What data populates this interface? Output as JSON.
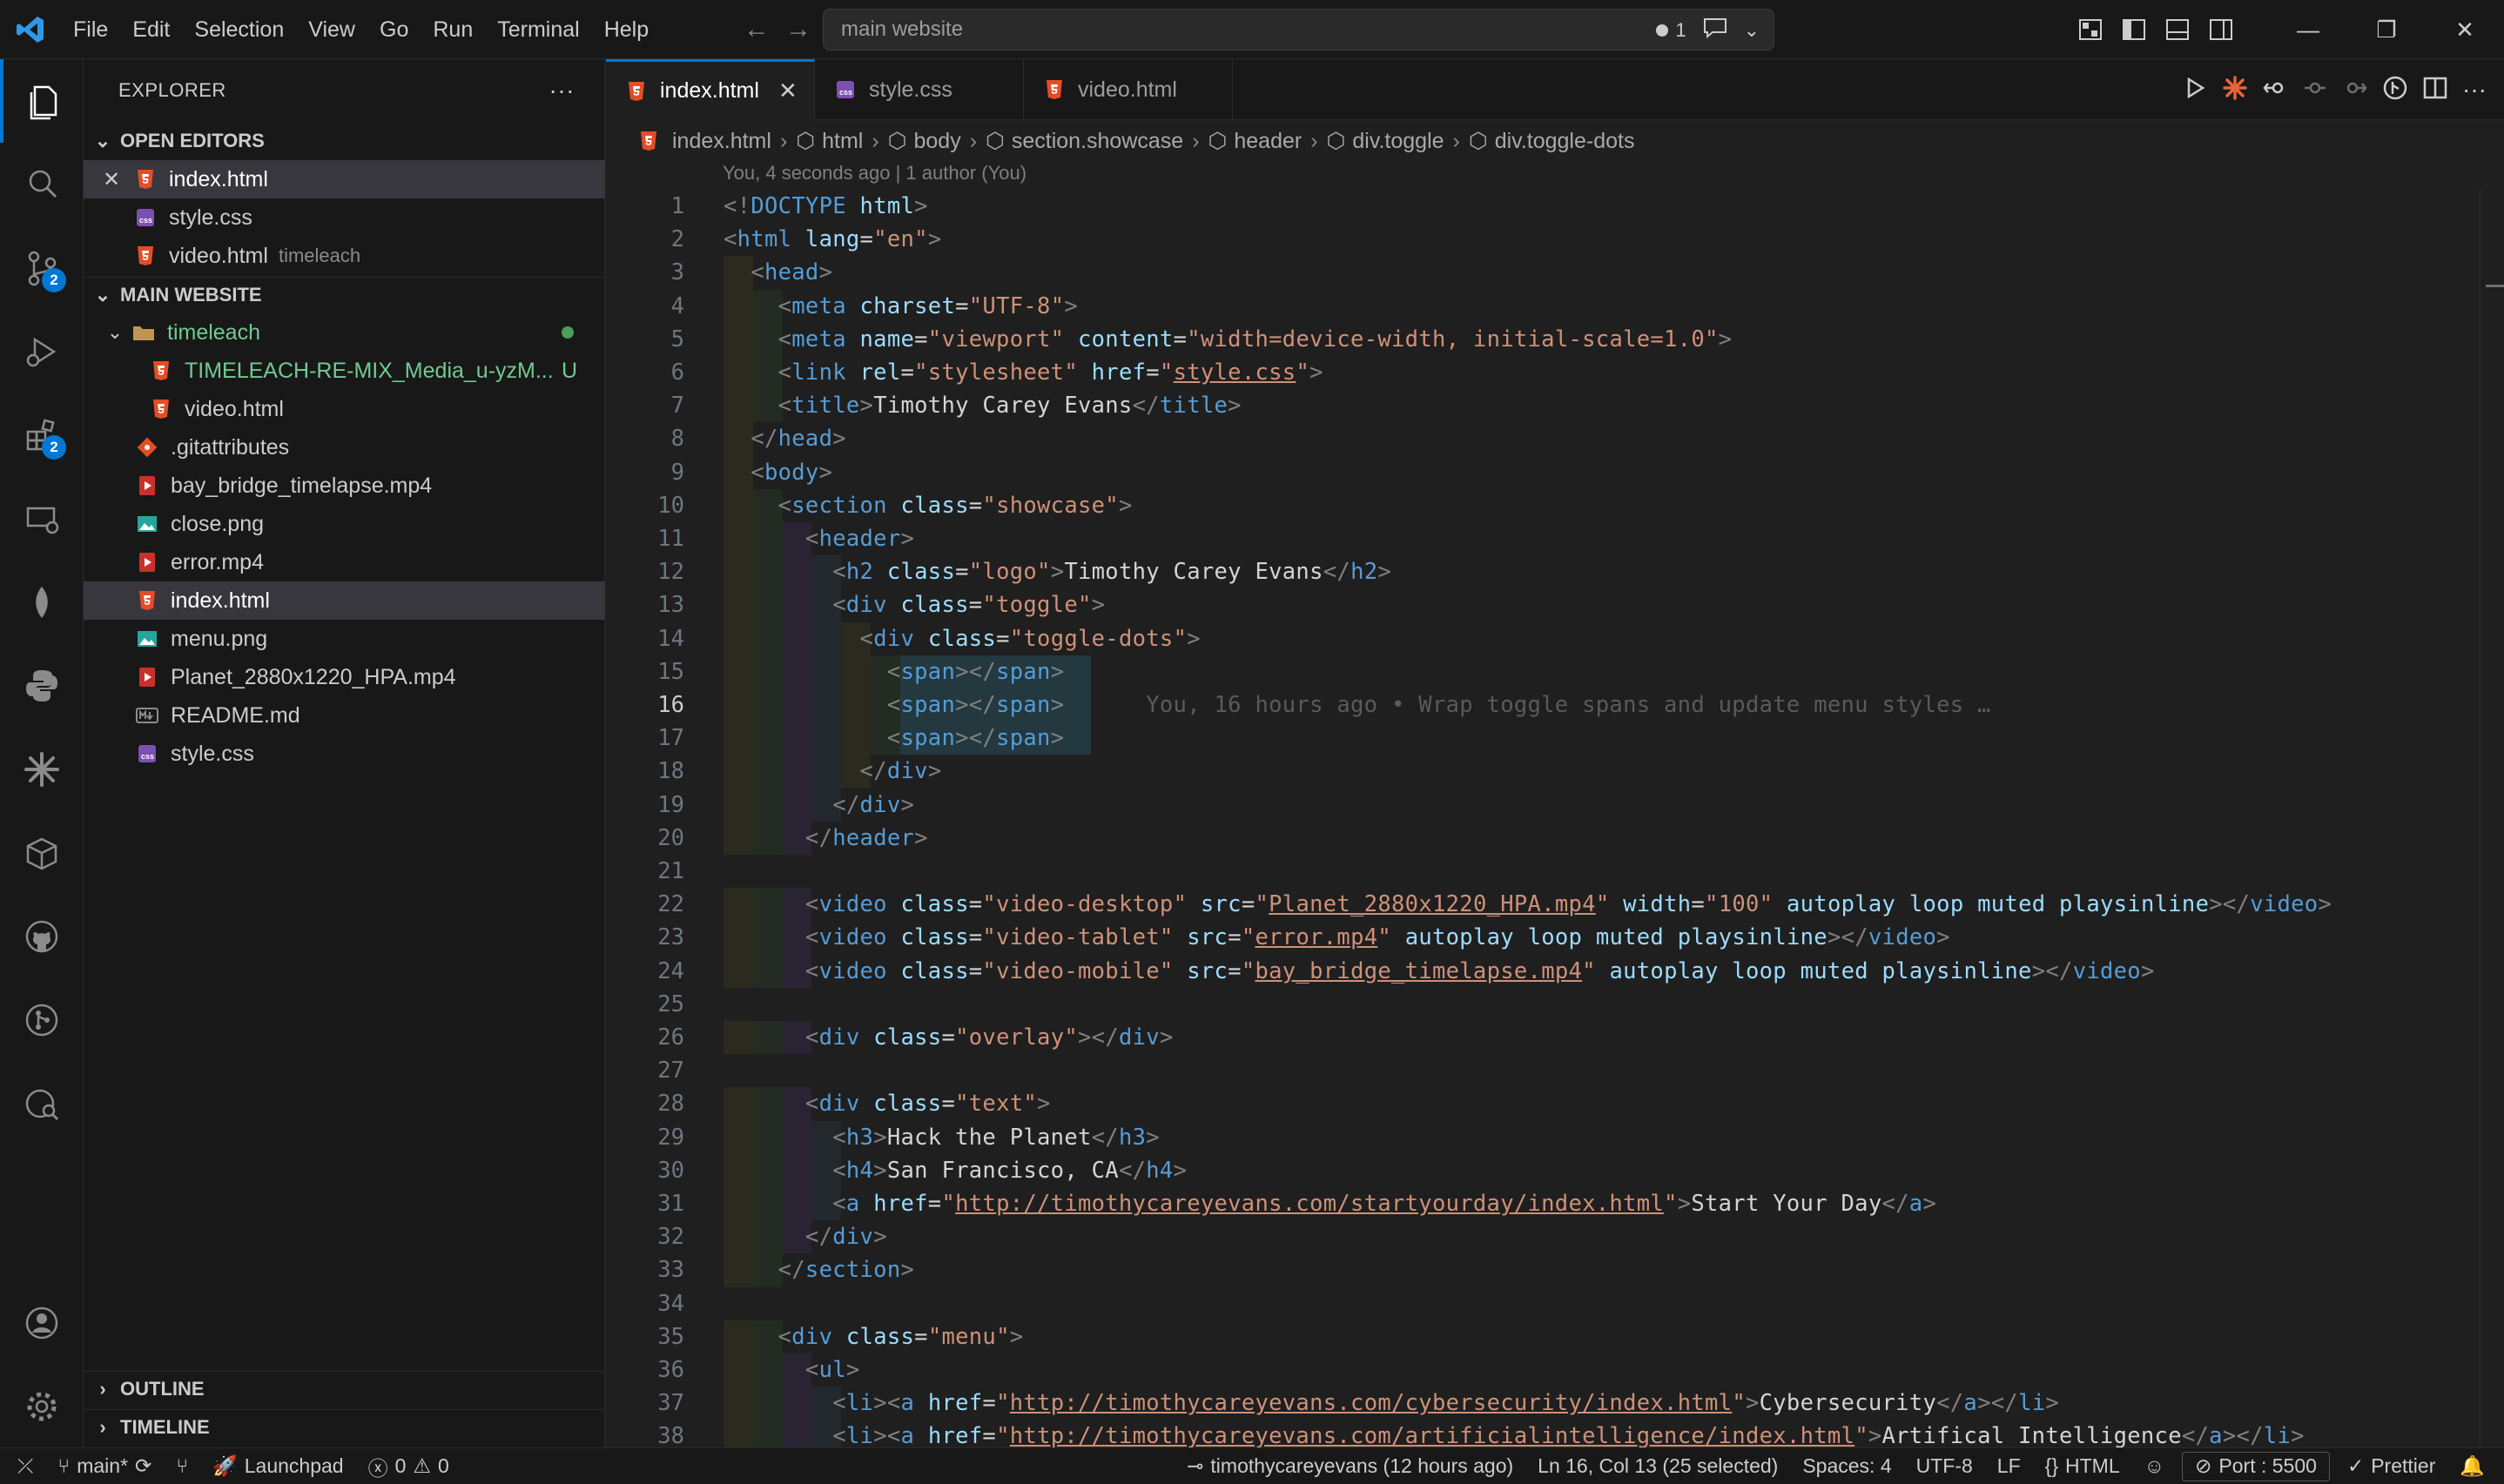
{
  "menu": [
    "File",
    "Edit",
    "Selection",
    "View",
    "Go",
    "Run",
    "Terminal",
    "Help"
  ],
  "command_center": {
    "text": "main website",
    "problems": "1"
  },
  "sidebar": {
    "title": "EXPLORER",
    "open_editors_title": "OPEN EDITORS",
    "open_editors": [
      {
        "name": "index.html",
        "desc": "",
        "icon": "html5-icon"
      },
      {
        "name": "style.css",
        "desc": "",
        "icon": "css-icon"
      },
      {
        "name": "video.html",
        "desc": "timeleach",
        "icon": "html5-icon"
      }
    ],
    "workspace_title": "MAIN WEBSITE",
    "tree": [
      {
        "name": "timeleach",
        "type": "folder"
      },
      {
        "name": "TIMELEACH-RE-MIX_Media_u-yzM...",
        "badge": "U",
        "type": "file"
      },
      {
        "name": "video.html",
        "type": "file"
      },
      {
        "name": ".gitattributes",
        "type": "file"
      },
      {
        "name": "bay_bridge_timelapse.mp4",
        "type": "file"
      },
      {
        "name": "close.png",
        "type": "file"
      },
      {
        "name": "error.mp4",
        "type": "file"
      },
      {
        "name": "index.html",
        "type": "file"
      },
      {
        "name": "menu.png",
        "type": "file"
      },
      {
        "name": "Planet_2880x1220_HPA.mp4",
        "type": "file"
      },
      {
        "name": "README.md",
        "type": "file"
      },
      {
        "name": "style.css",
        "type": "file"
      }
    ],
    "outline": "OUTLINE",
    "timeline": "TIMELINE",
    "badges": {
      "scm": "2",
      "extensions": "2"
    }
  },
  "tabs": [
    {
      "label": "index.html"
    },
    {
      "label": "style.css"
    },
    {
      "label": "video.html"
    }
  ],
  "breadcrumb": [
    "index.html",
    "html",
    "body",
    "section.showcase",
    "header",
    "div.toggle",
    "div.toggle-dots"
  ],
  "blame_header": "You, 4 seconds ago | 1 author (You)",
  "inline_blame": "You, 16 hours ago • Wrap toggle spans and update menu styles …",
  "code_lines": [
    "<!DOCTYPE html>",
    "<html lang=\"en\">",
    "  <head>",
    "    <meta charset=\"UTF-8\">",
    "    <meta name=\"viewport\" content=\"width=device-width, initial-scale=1.0\">",
    "    <link rel=\"stylesheet\" href=\"style.css\">",
    "    <title>Timothy Carey Evans</title>",
    "  </head>",
    "  <body>",
    "    <section class=\"showcase\">",
    "      <header>",
    "        <h2 class=\"logo\">Timothy Carey Evans</h2>",
    "        <div class=\"toggle\">",
    "          <div class=\"toggle-dots\">",
    "            <span></span>",
    "            <span></span>",
    "            <span></span>",
    "          </div>",
    "        </div>",
    "      </header>",
    "",
    "      <video class=\"video-desktop\" src=\"Planet_2880x1220_HPA.mp4\" width=\"100\" autoplay loop muted playsinline></video>",
    "      <video class=\"video-tablet\" src=\"error.mp4\" autoplay loop muted playsinline></video>",
    "      <video class=\"video-mobile\" src=\"bay_bridge_timelapse.mp4\" autoplay loop muted playsinline></video>",
    "",
    "      <div class=\"overlay\"></div>",
    "",
    "      <div class=\"text\">",
    "        <h3>Hack the Planet</h3>",
    "        <h4>San Francisco, CA</h4>",
    "        <a href=\"http://timothycareyevans.com/startyourday/index.html\">Start Your Day</a>",
    "      </div>",
    "    </section>",
    "",
    "    <div class=\"menu\">",
    "      <ul>",
    "        <li><a href=\"http://timothycareyevans.com/cybersecurity/index.html\">Cybersecurity</a></li>",
    "        <li><a href=\"http://timothycareyevans.com/artificialintelligence/index.html\">Artifical Intelligence</a></li>"
  ],
  "current_line": 16,
  "status": {
    "branch": "main*",
    "launchpad": "Launchpad",
    "errors": "0",
    "warnings": "0",
    "blame": "timothycareyevans (12 hours ago)",
    "position": "Ln 16, Col 13 (25 selected)",
    "spaces": "Spaces: 4",
    "encoding": "UTF-8",
    "eol": "LF",
    "language": "HTML",
    "port": "Port : 5500",
    "prettier": "Prettier"
  }
}
